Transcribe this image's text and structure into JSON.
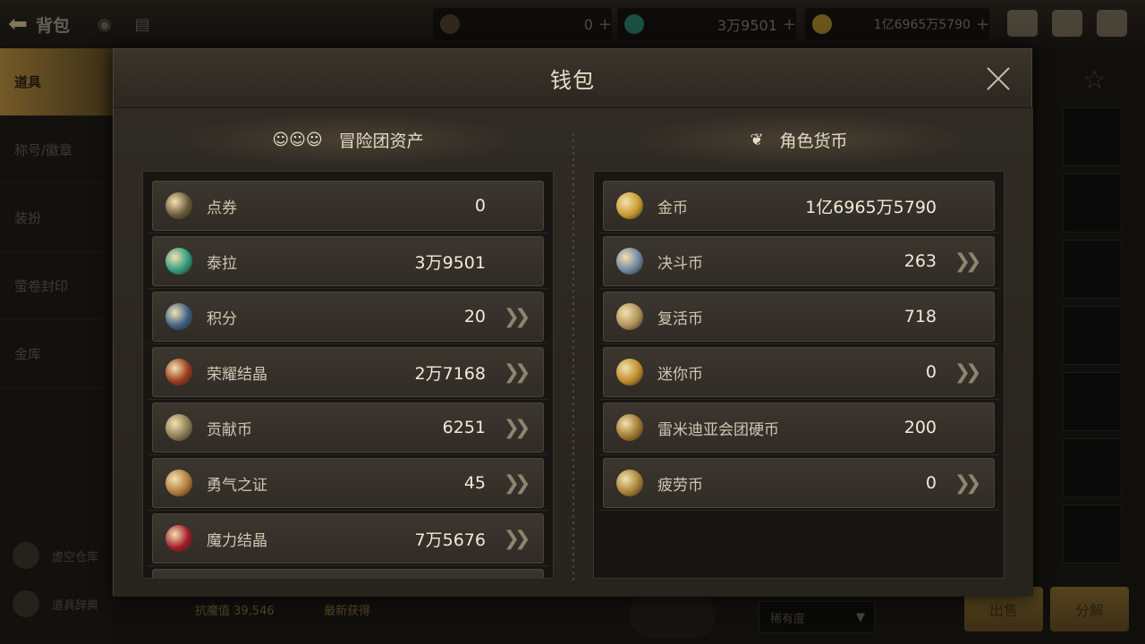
{
  "topbar": {
    "title": "背包",
    "back_icon": "back-arrow-icon",
    "currencies": [
      {
        "icon": "ticket-icon",
        "value": "0"
      },
      {
        "icon": "tera-crystal-icon",
        "value": "3万9501"
      },
      {
        "icon": "gold-coin-icon",
        "value": "1亿6965万5790"
      }
    ]
  },
  "sidebar": {
    "items": [
      "道具",
      "称号/徽章",
      "装扮",
      "萤卷封印",
      "金库"
    ],
    "bottom": [
      "虚空仓库",
      "道具辞典"
    ]
  },
  "bottombar": {
    "power_label": "抗魔值 39,546",
    "tag": "最新获得",
    "sort": "稀有度",
    "sell_button": "出售",
    "dismantle_button": "分解"
  },
  "modal": {
    "title": "钱包",
    "left_panel": {
      "title": "冒险团资产",
      "items": [
        {
          "label": "点券",
          "value": "0",
          "icon": "ticket-icon",
          "color": "#6b5b3b",
          "arrow": false
        },
        {
          "label": "泰拉",
          "value": "3万9501",
          "icon": "tera-crystal-icon",
          "color": "#2e9a7e",
          "arrow": false
        },
        {
          "label": "积分",
          "value": "20",
          "icon": "points-icon",
          "color": "#3a5f86",
          "arrow": true
        },
        {
          "label": "荣耀结晶",
          "value": "2万7168",
          "icon": "trophy-icon",
          "color": "#9a3a1d",
          "arrow": true
        },
        {
          "label": "贡献币",
          "value": "6251",
          "icon": "contribution-coin-icon",
          "color": "#8a7a55",
          "arrow": true
        },
        {
          "label": "勇气之证",
          "value": "45",
          "icon": "courage-badge-icon",
          "color": "#b07a3a",
          "arrow": true
        },
        {
          "label": "魔力结晶",
          "value": "7万5676",
          "icon": "mana-crystal-icon",
          "color": "#a01a2a",
          "arrow": true
        }
      ]
    },
    "right_panel": {
      "title": "角色货币",
      "items": [
        {
          "label": "金币",
          "value": "1亿6965万5790",
          "icon": "gold-coin-icon",
          "color": "#c79a2e",
          "arrow": false
        },
        {
          "label": "决斗币",
          "value": "263",
          "icon": "duel-coin-icon",
          "color": "#6d86a2",
          "arrow": true
        },
        {
          "label": "复活币",
          "value": "718",
          "icon": "revive-coin-icon",
          "color": "#b08f58",
          "arrow": false
        },
        {
          "label": "迷你币",
          "value": "0",
          "icon": "mini-coin-icon",
          "color": "#c08a2a",
          "arrow": true
        },
        {
          "label": "雷米迪亚会团硬币",
          "value": "200",
          "icon": "remedia-coin-icon",
          "color": "#a0752e",
          "arrow": false
        },
        {
          "label": "疲劳币",
          "value": "0",
          "icon": "fatigue-coin-icon",
          "color": "#a78035",
          "arrow": true
        }
      ]
    }
  }
}
